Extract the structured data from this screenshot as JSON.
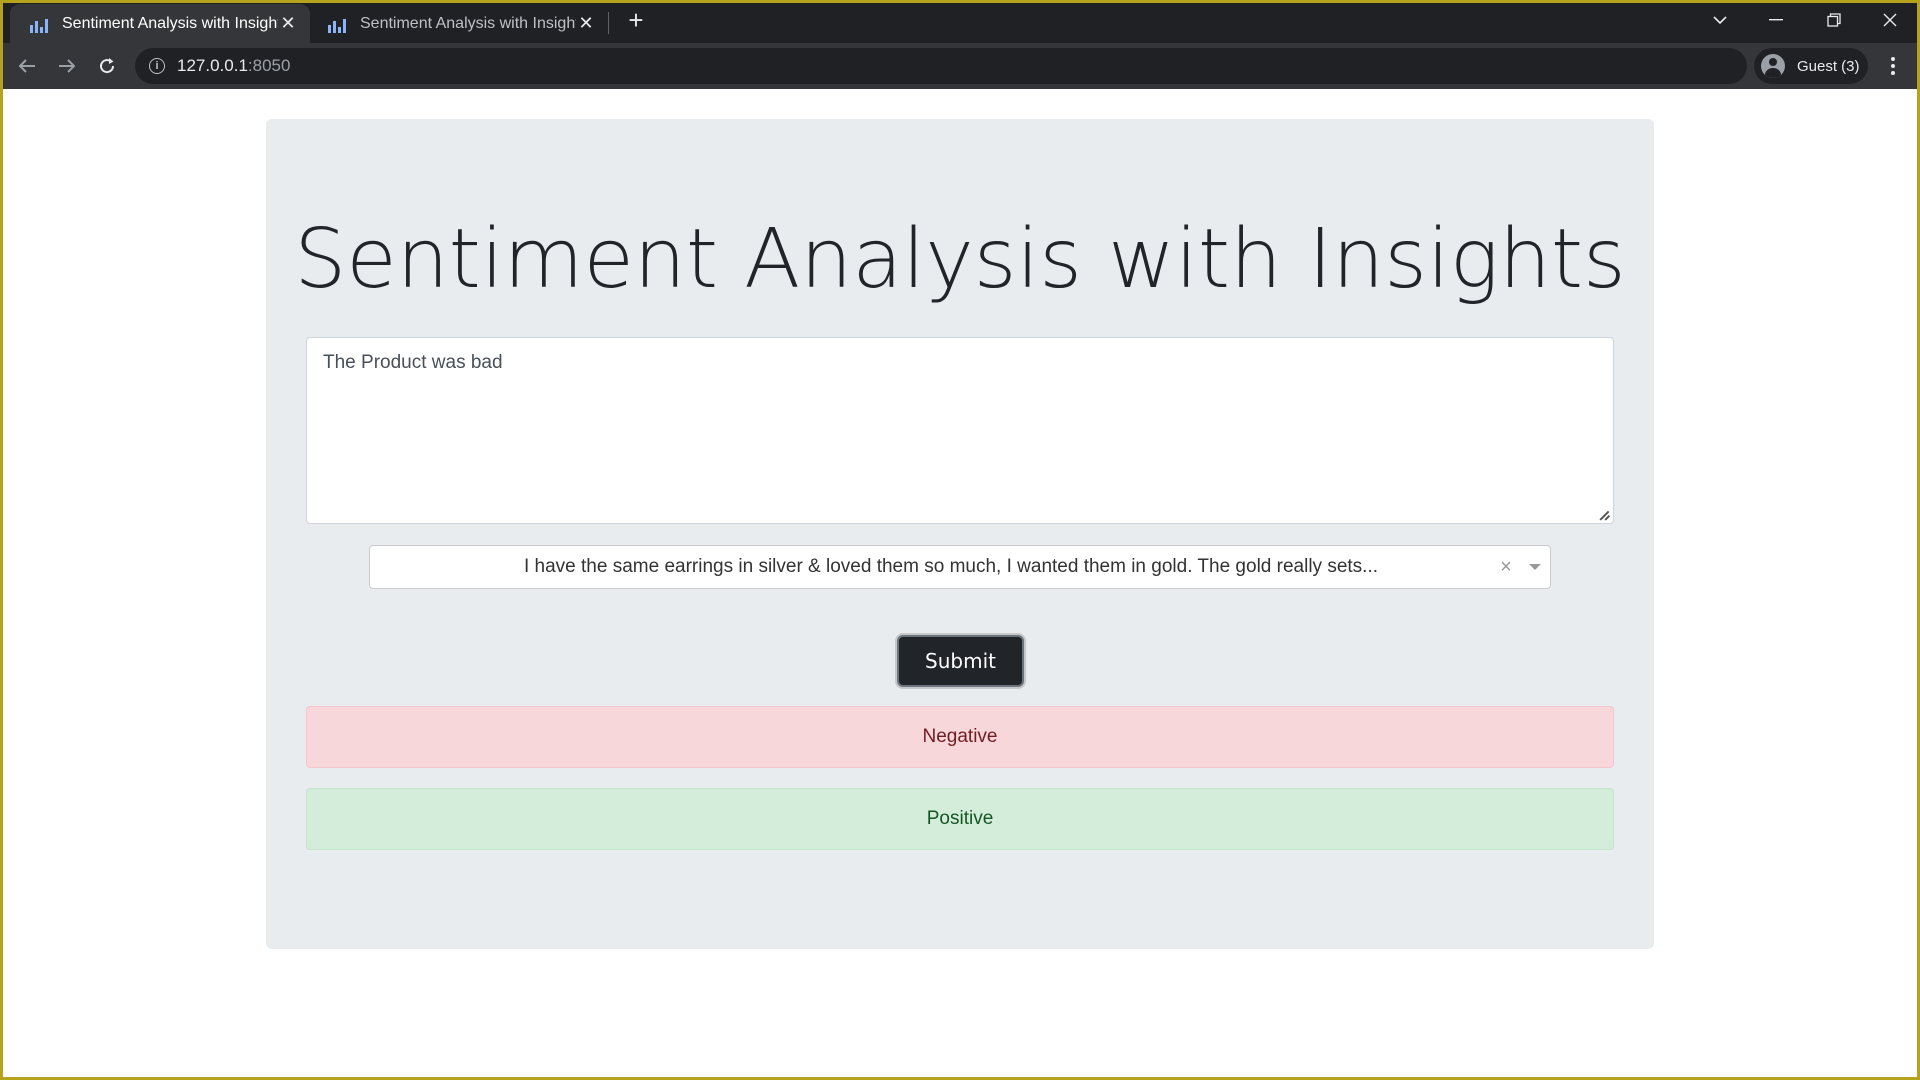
{
  "browser": {
    "tabs": [
      {
        "title": "Sentiment Analysis with Insights",
        "active": true
      },
      {
        "title": "Sentiment Analysis with Insights",
        "active": false
      }
    ],
    "url_host": "127.0.0.1",
    "url_port": ":8050",
    "profile_label": "Guest (3)"
  },
  "page": {
    "title": "Sentiment Analysis with Insights",
    "review_text": "The Product was bad",
    "selected_review": "I have the same earrings in silver & loved them so much, I wanted them in gold. The gold really sets...",
    "submit_label": "Submit",
    "result_negative": "Negative",
    "result_positive": "Positive"
  },
  "colors": {
    "jumbotron_bg": "#e9ecef",
    "negative_bg": "#f8d7da",
    "positive_bg": "#d4edda",
    "button_bg": "#212529"
  }
}
